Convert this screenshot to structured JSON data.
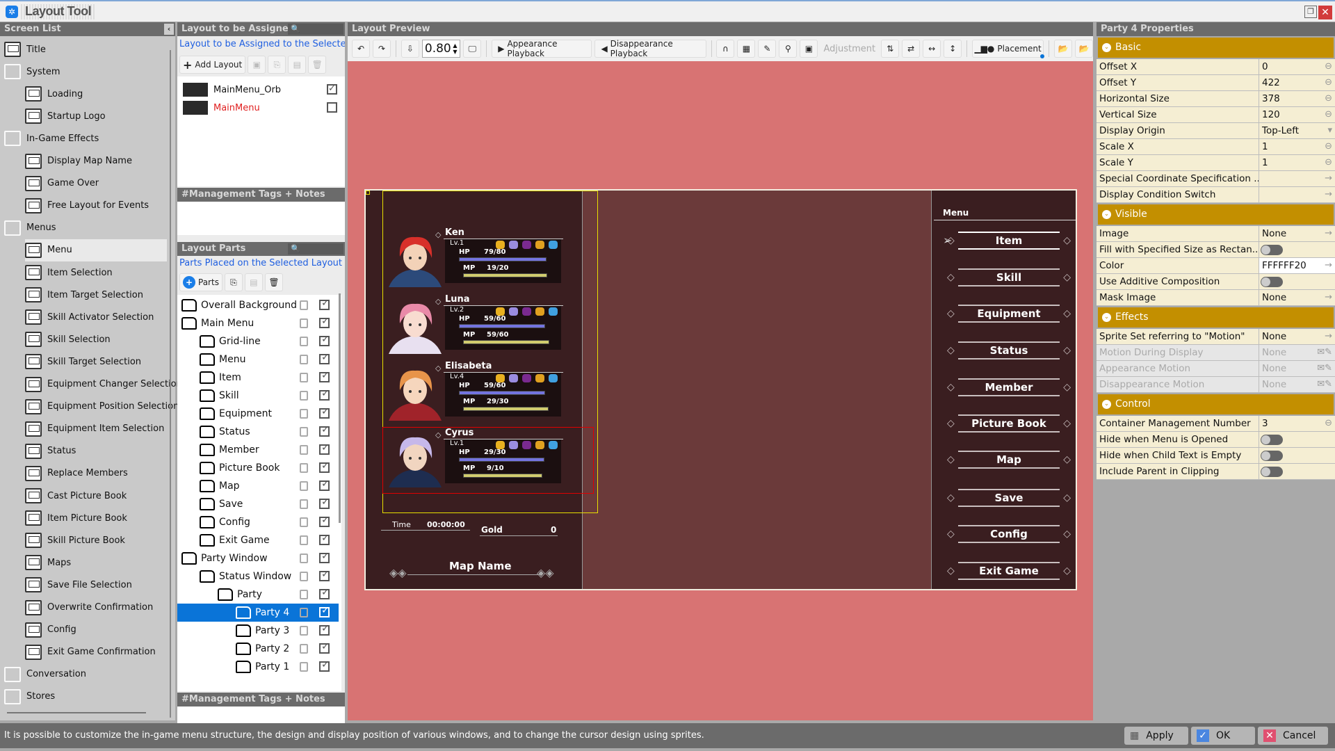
{
  "app": {
    "title": "Layout Tool"
  },
  "screen_list": {
    "header": "Screen List",
    "items": [
      {
        "label": "Title",
        "level": 0,
        "icon": "monitor-icon"
      },
      {
        "label": "System",
        "level": 0,
        "icon": "folder-icon"
      },
      {
        "label": "Loading",
        "level": 1,
        "icon": "monitor-icon"
      },
      {
        "label": "Startup Logo",
        "level": 1,
        "icon": "monitor-icon"
      },
      {
        "label": "In-Game Effects",
        "level": 0,
        "icon": "folder-icon"
      },
      {
        "label": "Display Map Name",
        "level": 1,
        "icon": "monitor-icon"
      },
      {
        "label": "Game Over",
        "level": 1,
        "icon": "monitor-icon"
      },
      {
        "label": "Free Layout for Events",
        "level": 1,
        "icon": "monitor-icon"
      },
      {
        "label": "Menus",
        "level": 0,
        "icon": "folder-icon"
      },
      {
        "label": "Menu",
        "level": 1,
        "icon": "monitor-icon",
        "selected": true
      },
      {
        "label": "Item Selection",
        "level": 1,
        "icon": "monitor-icon"
      },
      {
        "label": "Item Target Selection",
        "level": 1,
        "icon": "monitor-icon"
      },
      {
        "label": "Skill Activator Selection",
        "level": 1,
        "icon": "monitor-icon"
      },
      {
        "label": "Skill Selection",
        "level": 1,
        "icon": "monitor-icon"
      },
      {
        "label": "Skill Target Selection",
        "level": 1,
        "icon": "monitor-icon"
      },
      {
        "label": "Equipment Changer Selection",
        "level": 1,
        "icon": "monitor-icon"
      },
      {
        "label": "Equipment Position Selection",
        "level": 1,
        "icon": "monitor-icon"
      },
      {
        "label": "Equipment Item Selection",
        "level": 1,
        "icon": "monitor-icon"
      },
      {
        "label": "Status",
        "level": 1,
        "icon": "monitor-icon"
      },
      {
        "label": "Replace Members",
        "level": 1,
        "icon": "monitor-icon"
      },
      {
        "label": "Cast Picture Book",
        "level": 1,
        "icon": "monitor-icon"
      },
      {
        "label": "Item Picture Book",
        "level": 1,
        "icon": "monitor-icon"
      },
      {
        "label": "Skill Picture Book",
        "level": 1,
        "icon": "monitor-icon"
      },
      {
        "label": "Maps",
        "level": 1,
        "icon": "monitor-icon"
      },
      {
        "label": "Save File Selection",
        "level": 1,
        "icon": "monitor-icon"
      },
      {
        "label": "Overwrite Confirmation",
        "level": 1,
        "icon": "monitor-icon"
      },
      {
        "label": "Config",
        "level": 1,
        "icon": "monitor-icon"
      },
      {
        "label": "Exit Game Confirmation",
        "level": 1,
        "icon": "monitor-icon"
      },
      {
        "label": "Conversation",
        "level": 0,
        "icon": "folder-icon"
      },
      {
        "label": "Stores",
        "level": 0,
        "icon": "folder-icon"
      }
    ]
  },
  "assign": {
    "header": "Layout to be Assigned",
    "subtitle": "Layout to be Assigned to the Selected",
    "add_label": "Add Layout",
    "layouts": [
      {
        "label": "MainMenu_Orb",
        "checked": true
      },
      {
        "label": "MainMenu",
        "checked": false,
        "color": "#e02020"
      }
    ],
    "notes_header": "#Management Tags + Notes"
  },
  "parts": {
    "header": "Layout Parts",
    "subtitle": "Parts Placed on the Selected Layout",
    "add_label": "Parts",
    "items": [
      {
        "label": "Overall Background",
        "level": 0
      },
      {
        "label": "Main Menu",
        "level": 0
      },
      {
        "label": "Grid-line",
        "level": 1
      },
      {
        "label": "Menu",
        "level": 1
      },
      {
        "label": "Item",
        "level": 1
      },
      {
        "label": "Skill",
        "level": 1
      },
      {
        "label": "Equipment",
        "level": 1
      },
      {
        "label": "Status",
        "level": 1
      },
      {
        "label": "Member",
        "level": 1
      },
      {
        "label": "Picture Book",
        "level": 1
      },
      {
        "label": "Map",
        "level": 1
      },
      {
        "label": "Save",
        "level": 1
      },
      {
        "label": "Config",
        "level": 1
      },
      {
        "label": "Exit Game",
        "level": 1
      },
      {
        "label": "Party Window",
        "level": 0
      },
      {
        "label": "Status Window",
        "level": 1
      },
      {
        "label": "Party",
        "level": 2
      },
      {
        "label": "Party 4",
        "level": 3,
        "selected": true
      },
      {
        "label": "Party 3",
        "level": 3
      },
      {
        "label": "Party 2",
        "level": 3
      },
      {
        "label": "Party 1",
        "level": 3
      }
    ],
    "notes_header": "#Management Tags + Notes"
  },
  "preview": {
    "header": "Layout Preview",
    "zoom": "0.80",
    "appearance_label": "Appearance Playback",
    "disappearance_label": "Disappearance Playback",
    "adjustment_label": "Adjustment",
    "placement_label": "Placement",
    "canvas_color": "#d87373"
  },
  "game": {
    "members": [
      {
        "name": "Ken",
        "level": "Lv.1",
        "hp_label": "HP",
        "hp": "79/80",
        "hp_frac": 0.99,
        "mp_label": "MP",
        "mp": "19/20",
        "mp_frac": 0.95,
        "hair": "#d8302a",
        "skin": "#f3d2b8",
        "outfit": "#2c4a7a"
      },
      {
        "name": "Luna",
        "level": "Lv.2",
        "hp_label": "HP",
        "hp": "59/60",
        "hp_frac": 0.98,
        "mp_label": "MP",
        "mp": "59/60",
        "mp_frac": 0.98,
        "hair": "#e98aa8",
        "skin": "#f8dcd0",
        "outfit": "#e8e0f0"
      },
      {
        "name": "Elisabeta",
        "level": "Lv.4",
        "hp_label": "HP",
        "hp": "59/60",
        "hp_frac": 0.98,
        "mp_label": "MP",
        "mp": "29/30",
        "mp_frac": 0.97,
        "hair": "#e8944a",
        "skin": "#f6d6bd",
        "outfit": "#a0232a"
      },
      {
        "name": "Cyrus",
        "level": "Lv.1",
        "hp_label": "HP",
        "hp": "29/30",
        "hp_frac": 0.97,
        "mp_label": "MP",
        "mp": "9/10",
        "mp_frac": 0.9,
        "hair": "#c6b8ea",
        "skin": "#f1d5c0",
        "outfit": "#1e2d50"
      }
    ],
    "time_label": "Time",
    "time": "00:00:00",
    "gold_label": "Gold",
    "gold": "0",
    "map_name": "Map Name",
    "menu_label": "Menu",
    "menu_items": [
      "Item",
      "Skill",
      "Equipment",
      "Status",
      "Member",
      "Picture Book",
      "Map",
      "Save",
      "Config",
      "Exit Game"
    ],
    "selected_menu": "Item"
  },
  "properties": {
    "header": "Party 4 Properties",
    "sections": [
      {
        "title": "Basic",
        "rows": [
          {
            "label": "Offset X",
            "value": "0",
            "control": "spin"
          },
          {
            "label": "Offset Y",
            "value": "422",
            "control": "spin"
          },
          {
            "label": "Horizontal Size",
            "value": "378",
            "control": "spin"
          },
          {
            "label": "Vertical Size",
            "value": "120",
            "control": "spin"
          },
          {
            "label": "Display Origin",
            "value": "Top-Left",
            "control": "dropdown"
          },
          {
            "label": "Scale X",
            "value": "1",
            "control": "spin"
          },
          {
            "label": "Scale Y",
            "value": "1",
            "control": "spin"
          },
          {
            "label": "Special Coordinate Specification ...",
            "value": "",
            "control": "arrow"
          },
          {
            "label": "Display Condition Switch",
            "value": "",
            "control": "arrow"
          }
        ]
      },
      {
        "title": "Visible",
        "rows": [
          {
            "label": "Image",
            "value": "None",
            "control": "arrow"
          },
          {
            "label": "Fill with Specified Size as Rectan...",
            "value": "",
            "control": "toggle"
          },
          {
            "label": "Color",
            "value": "FFFFFF20",
            "control": "arrow",
            "white": true
          },
          {
            "label": "Use Additive Composition",
            "value": "",
            "control": "toggle"
          },
          {
            "label": "Mask Image",
            "value": "None",
            "control": "arrow"
          }
        ]
      },
      {
        "title": "Effects",
        "rows": [
          {
            "label": "Sprite Set referring to \"Motion\"",
            "value": "None",
            "control": "arrow"
          },
          {
            "label": "Motion During Display",
            "value": "None",
            "control": "edit",
            "disabled": true
          },
          {
            "label": "Appearance Motion",
            "value": "None",
            "control": "edit",
            "disabled": true
          },
          {
            "label": "Disappearance Motion",
            "value": "None",
            "control": "edit",
            "disabled": true
          }
        ]
      },
      {
        "title": "Control",
        "rows": [
          {
            "label": "Container Management Number",
            "value": "3",
            "control": "spin"
          },
          {
            "label": "Hide when Menu is Opened",
            "value": "",
            "control": "toggle"
          },
          {
            "label": "Hide when Child Text is Empty",
            "value": "",
            "control": "toggle"
          },
          {
            "label": "Include Parent in Clipping",
            "value": "",
            "control": "toggle"
          }
        ]
      }
    ]
  },
  "status": {
    "text": "It is possible to customize the in-game menu structure, the design and display position of various windows, and to change the cursor design using sprites.",
    "apply": "Apply",
    "ok": "OK",
    "cancel": "Cancel"
  },
  "colors": {
    "band": "#c38f00",
    "selection": "#0a74d8",
    "hp_bar": "#7474e0",
    "mp_bar": "#d2cc6e"
  }
}
